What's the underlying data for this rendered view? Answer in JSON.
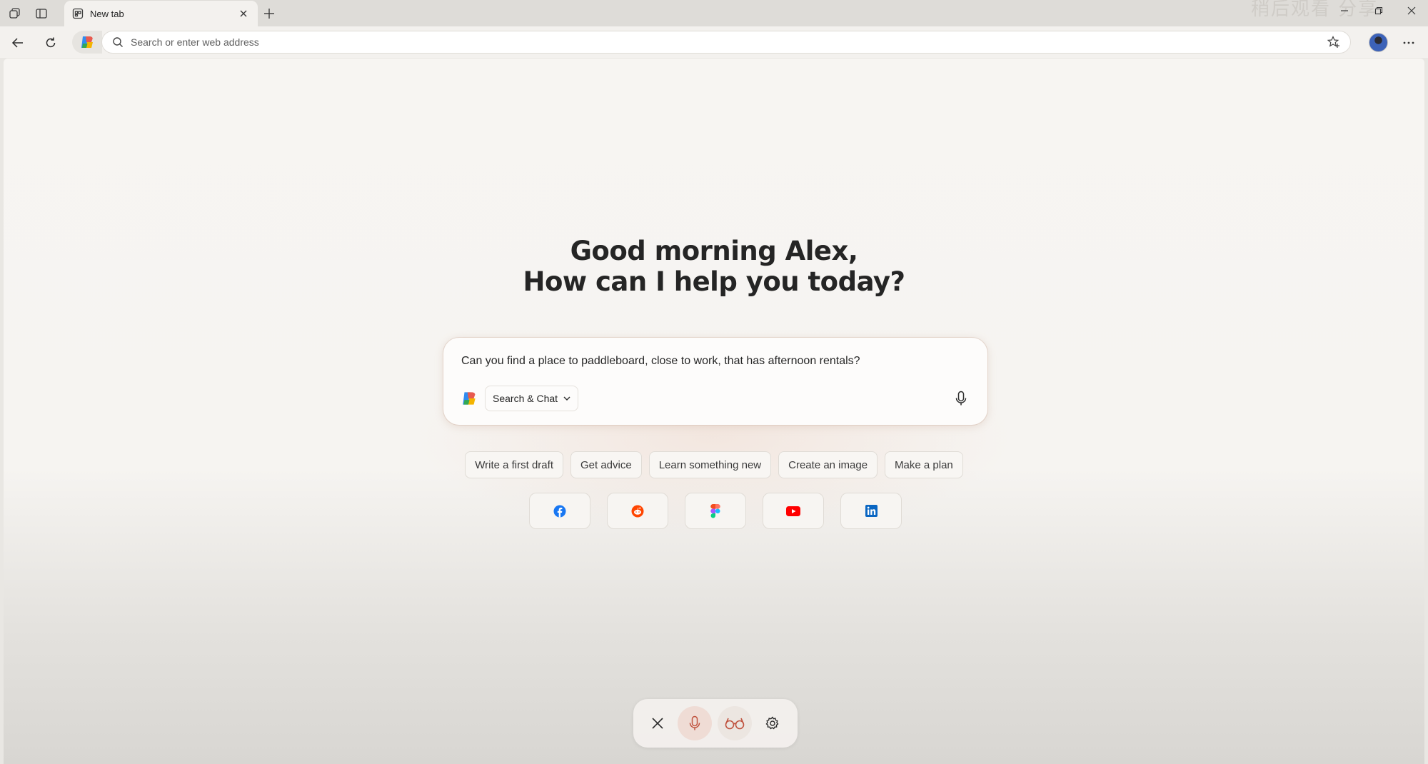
{
  "browser": {
    "tab": {
      "title": "New tab"
    },
    "watermark": "稍后观看   分享",
    "address_bar": {
      "placeholder": "Search or enter web address",
      "value": ""
    }
  },
  "page": {
    "greeting_line1": "Good morning Alex,",
    "greeting_line2": "How can I help you today?",
    "composer": {
      "text": "Can you find a place to paddleboard, close to work, that has afternoon rentals?",
      "mode_label": "Search & Chat"
    },
    "suggestions": [
      "Write a first draft",
      "Get advice",
      "Learn something new",
      "Create an image",
      "Make a plan"
    ],
    "site_shortcuts": [
      {
        "name": "facebook-icon",
        "color": "#1877f2"
      },
      {
        "name": "reddit-icon",
        "color": "#ff4500"
      },
      {
        "name": "figma-icon",
        "color": "#f24e1e"
      },
      {
        "name": "youtube-icon",
        "color": "#ff0000"
      },
      {
        "name": "linkedin-icon",
        "color": "#0a66c2"
      }
    ]
  },
  "colors": {
    "accent_mic": "#c0533f",
    "page_bg": "#f7f5f2"
  }
}
